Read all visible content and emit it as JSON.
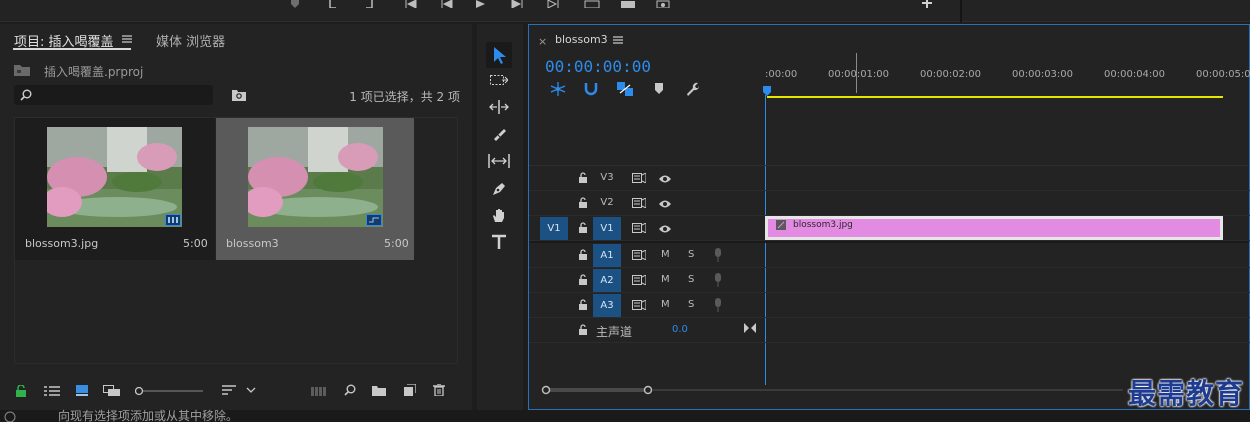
{
  "project_panel": {
    "tab_active": "项目: 插入喝覆盖",
    "tab_inactive": "媒体 浏览器",
    "project_file": "插入喝覆盖.prproj",
    "search_placeholder": "",
    "selection_status": "1 项已选择，共 2 项",
    "items": [
      {
        "name": "blossom3.jpg",
        "duration": "5:00",
        "selected": false,
        "kind": "still-image"
      },
      {
        "name": "blossom3",
        "duration": "5:00",
        "selected": true,
        "kind": "sequence"
      }
    ]
  },
  "timeline": {
    "sequence_tab": "blossom3",
    "timecode": "00:00:00:00",
    "ruler_labels": [
      ":00:00",
      "00:00:01:00",
      "00:00:02:00",
      "00:00:03:00",
      "00:00:04:00",
      "00:00:05:00"
    ],
    "tracks": {
      "video": [
        {
          "label": "V3",
          "source": ""
        },
        {
          "label": "V2",
          "source": ""
        },
        {
          "label": "V1",
          "source": "V1"
        }
      ],
      "audio": [
        {
          "label": "A1"
        },
        {
          "label": "A2"
        },
        {
          "label": "A3"
        }
      ],
      "mute_label": "M",
      "solo_label": "S",
      "master_label": "主声道",
      "master_value": "0.0"
    },
    "clip": {
      "name": "blossom3.jpg",
      "color": "#e38ae3"
    }
  },
  "status_bar": {
    "text": "向现有选择项添加或从其中移除。"
  },
  "watermark": "最需教育",
  "colors": {
    "accent": "#2d8ceb",
    "work_area": "#e6e600",
    "clip": "#e38ae3",
    "track_blue": "#1c5184"
  }
}
